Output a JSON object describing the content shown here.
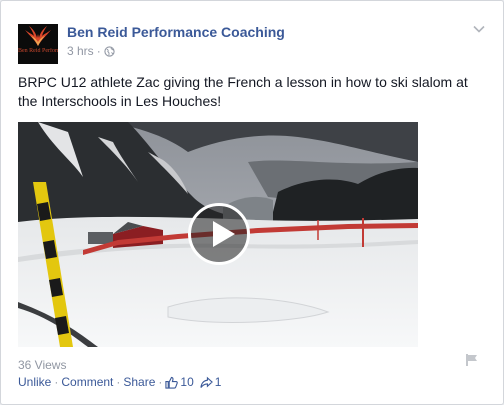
{
  "post": {
    "page_name": "Ben Reid Performance Coaching",
    "avatar_logo_text": "Ben Reid Performance Coach",
    "timestamp": "3 hrs",
    "meta_separator": "·",
    "privacy_icon": "globe-icon",
    "text": "BRPC U12 athlete Zac giving the French a lesson in how to ski slalom at the Interschools in Les Houches!",
    "video": {
      "play_icon": "play-icon"
    },
    "views": "36 Views"
  },
  "actions": {
    "unlike": "Unlike",
    "comment": "Comment",
    "share": "Share",
    "separator": "·",
    "like_icon": "thumbs-up-icon",
    "like_count": "10",
    "share_icon": "share-arrow-icon",
    "share_count": "1"
  },
  "colors": {
    "link": "#3b5998",
    "meta": "#9197a3",
    "text": "#141823"
  }
}
